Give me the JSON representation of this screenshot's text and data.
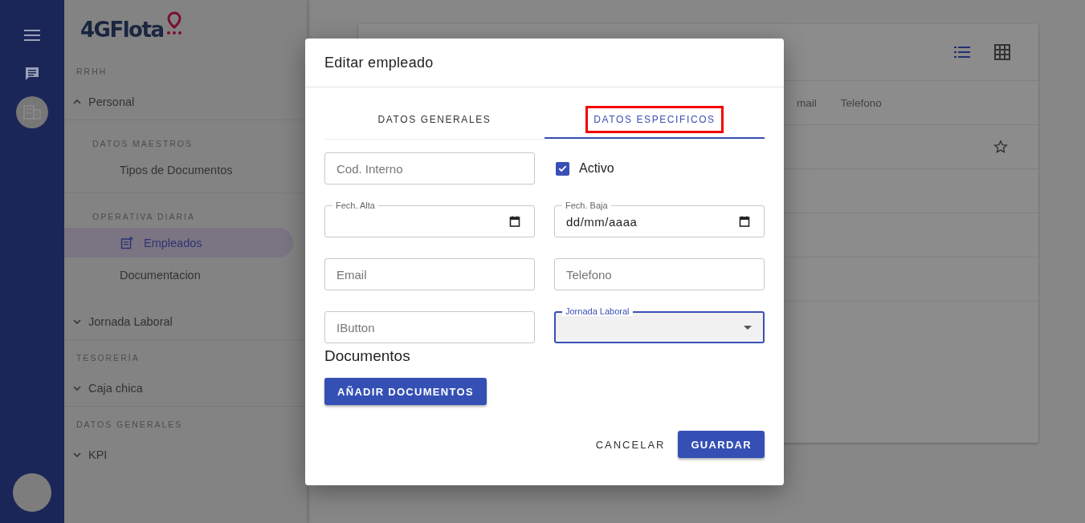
{
  "rail": {
    "items": [
      {
        "kind": "menu",
        "selected": false
      },
      {
        "kind": "chat",
        "selected": false
      },
      {
        "kind": "building",
        "selected": true
      }
    ]
  },
  "sidebar": {
    "logo": "4GFlota",
    "sections": [
      {
        "title": "RRHH",
        "groups": [
          {
            "label": "Personal",
            "expanded": true,
            "children": [
              {
                "title": "DATOS MAESTROS",
                "items": [
                  {
                    "label": "Tipos de Documentos",
                    "selected": false
                  }
                ]
              },
              {
                "title": "OPERATIVA DIARIA",
                "items": [
                  {
                    "label": "Empleados",
                    "selected": true
                  },
                  {
                    "label": "Documentacion",
                    "selected": false
                  }
                ]
              }
            ]
          },
          {
            "label": "Jornada Laboral",
            "expanded": false
          }
        ]
      },
      {
        "title": "TESORERÍA",
        "groups": [
          {
            "label": "Caja chica",
            "expanded": false
          }
        ]
      },
      {
        "title": "DATOS GENERALES",
        "groups": [
          {
            "label": "KPI",
            "expanded": false
          }
        ]
      }
    ]
  },
  "table": {
    "view_modes": [
      {
        "kind": "list",
        "selected": true
      },
      {
        "kind": "grid",
        "selected": false
      }
    ],
    "columns": [
      "mail",
      "Telefono"
    ],
    "rows": [
      {
        "starred": false
      }
    ]
  },
  "dialog": {
    "title": "Editar empleado",
    "tabs": [
      {
        "label": "DATOS GENERALES",
        "selected": false,
        "highlighted": false
      },
      {
        "label": "DATOS ESPECIFICOS",
        "selected": true,
        "highlighted": true
      }
    ],
    "fields": [
      {
        "kind": "text",
        "placeholder": "Cod. Interno"
      },
      {
        "kind": "checkbox",
        "label": "Activo",
        "checked": true
      },
      {
        "kind": "date",
        "label": "Fech. Alta"
      },
      {
        "kind": "date",
        "label": "Fech. Baja",
        "value": "dd/mm/aaaa"
      },
      {
        "kind": "text",
        "placeholder": "Email"
      },
      {
        "kind": "text",
        "placeholder": "Telefono"
      },
      {
        "kind": "text",
        "placeholder": "IButton"
      },
      {
        "kind": "select",
        "label": "Jornada Laboral",
        "focused": true
      }
    ],
    "documents": {
      "title": "Documentos",
      "button": "AÑADIR DOCUMENTOS"
    },
    "buttons": [
      {
        "label": "CANCELAR",
        "kind": "text"
      },
      {
        "label": "GUARDAR",
        "kind": "primary"
      }
    ]
  }
}
